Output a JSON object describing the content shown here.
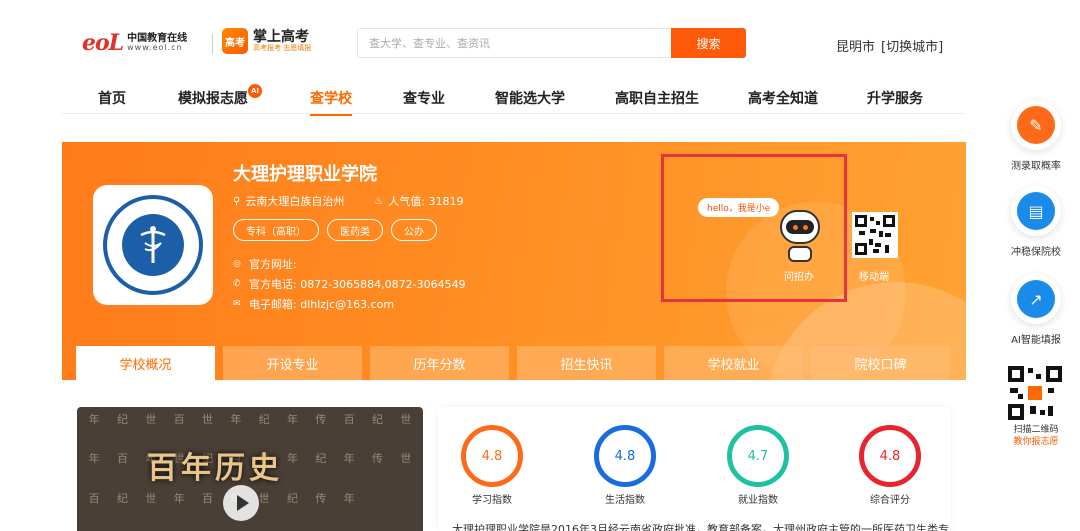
{
  "header": {
    "eol_mark": "eoL",
    "eol_cn": "中国教育在线",
    "eol_en": "www.eol.cn",
    "app_icon_text": "高考",
    "app_name": "掌上高考",
    "app_slogan": "高考报考 志愿填报",
    "search_placeholder": "查大学、查专业、查资讯",
    "search_button": "搜索",
    "city": "昆明市",
    "switch_city": "[切换城市]"
  },
  "nav": {
    "items": [
      "首页",
      "模拟报志愿",
      "查学校",
      "查专业",
      "智能选大学",
      "高职自主招生",
      "高考全知道",
      "升学服务"
    ],
    "active_index": 2,
    "ai_badge": "AI"
  },
  "school": {
    "name": "大理护理职业学院",
    "location": "云南大理白族自治州",
    "popularity_label": "人气值:",
    "popularity": "31819",
    "tags": [
      "专科（高职）",
      "医药类",
      "公办"
    ],
    "website_label": "官方网址:",
    "phone_label": "官方电话:",
    "phone": "0872-3065884,0872-3064549",
    "email_label": "电子邮箱:",
    "email": "dlhlzjc@163.com",
    "bubble": "hello，我是小e",
    "ask_label": "问招办",
    "mobile_label": "移动端"
  },
  "tabs": {
    "items": [
      "学校概况",
      "开设专业",
      "历年分数",
      "招生快讯",
      "学校就业",
      "院校口碑"
    ],
    "active_index": 0
  },
  "video": {
    "title": "百年历史",
    "grid_chars": "年纪世百世年纪年传百纪世年百年世纪百世年纪年传世百纪世年百年世纪传年"
  },
  "ratings": [
    {
      "value": "4.8",
      "label": "学习指数",
      "color": "#ff6a1a"
    },
    {
      "value": "4.8",
      "label": "生活指数",
      "color": "#1a6be0"
    },
    {
      "value": "4.7",
      "label": "就业指数",
      "color": "#1fc2a0"
    },
    {
      "value": "4.8",
      "label": "综合评分",
      "color": "#e6262e"
    }
  ],
  "intro_text": "大理护理职业学院是2016年3月经云南省政府批准，教育部备案，大理州政府主管的一所医药卫生类专",
  "sidebar": {
    "items": [
      {
        "label": "测录取概率",
        "color": "#ff6a1a",
        "icon": "pencil-icon"
      },
      {
        "label": "冲稳保院校",
        "color": "#1a8be8",
        "icon": "school-icon"
      },
      {
        "label": "AI智能填报",
        "color": "#1a8be8",
        "icon": "chart-icon"
      }
    ],
    "qr_line1": "扫描二维码",
    "qr_line2": "教你报志愿"
  },
  "colors": {
    "accent": "#ff6a00",
    "search_button": "#ff5a0a",
    "highlight_box": "#e8323c"
  }
}
